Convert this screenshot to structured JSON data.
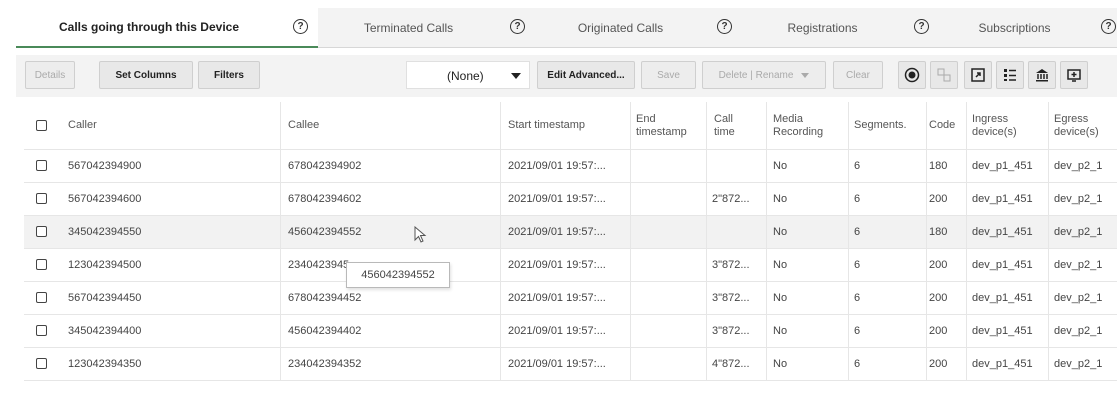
{
  "tabs": [
    {
      "label": "Calls going through this Device",
      "active": true
    },
    {
      "label": "Terminated Calls",
      "active": false
    },
    {
      "label": "Originated Calls",
      "active": false
    },
    {
      "label": "Registrations",
      "active": false
    },
    {
      "label": "Subscriptions",
      "active": false
    }
  ],
  "help_glyph": "?",
  "toolbar": {
    "details_label": "Details",
    "set_columns_label": "Set Columns",
    "filters_label": "Filters",
    "view_select_value": "(None)",
    "edit_advanced_label": "Edit Advanced...",
    "save_label": "Save",
    "delete_rename_label": "Delete | Rename",
    "clear_label": "Clear",
    "icons": [
      "record-icon",
      "compare-icon",
      "export-icon",
      "list-icon",
      "bank-icon",
      "display-icon"
    ]
  },
  "table": {
    "headers": {
      "caller": "Caller",
      "callee": "Callee",
      "start_timestamp": "Start timestamp",
      "end_timestamp": "End timestamp",
      "call_time": "Call time",
      "media_recording": "Media Recording",
      "segments": "Segments.",
      "code": "Code",
      "ingress_device": "Ingress device(s)",
      "egress_device": "Egress device(s)"
    },
    "rows": [
      {
        "caller": "567042394900",
        "callee": "678042394902",
        "start": "2021/09/01 19:57:...",
        "end": "",
        "call_time": "",
        "media": "No",
        "segments": "6",
        "code": "180",
        "ingress": "dev_p1_451",
        "egress": "dev_p2_1"
      },
      {
        "caller": "567042394600",
        "callee": "678042394602",
        "start": "2021/09/01 19:57:...",
        "end": "",
        "call_time": "2\"872...",
        "media": "No",
        "segments": "6",
        "code": "200",
        "ingress": "dev_p1_451",
        "egress": "dev_p2_1"
      },
      {
        "caller": "345042394550",
        "callee": "456042394552",
        "start": "2021/09/01 19:57:...",
        "end": "",
        "call_time": "",
        "media": "No",
        "segments": "6",
        "code": "180",
        "ingress": "dev_p1_451",
        "egress": "dev_p2_1"
      },
      {
        "caller": "123042394500",
        "callee": "2340423945",
        "start": "2021/09/01 19:57:...",
        "end": "",
        "call_time": "3\"872...",
        "media": "No",
        "segments": "6",
        "code": "200",
        "ingress": "dev_p1_451",
        "egress": "dev_p2_1"
      },
      {
        "caller": "567042394450",
        "callee": "678042394452",
        "start": "2021/09/01 19:57:...",
        "end": "",
        "call_time": "3\"872...",
        "media": "No",
        "segments": "6",
        "code": "200",
        "ingress": "dev_p1_451",
        "egress": "dev_p2_1"
      },
      {
        "caller": "345042394400",
        "callee": "456042394402",
        "start": "2021/09/01 19:57:...",
        "end": "",
        "call_time": "3\"872...",
        "media": "No",
        "segments": "6",
        "code": "200",
        "ingress": "dev_p1_451",
        "egress": "dev_p2_1"
      },
      {
        "caller": "123042394350",
        "callee": "234042394352",
        "start": "2021/09/01 19:57:...",
        "end": "",
        "call_time": "4\"872...",
        "media": "No",
        "segments": "6",
        "code": "200",
        "ingress": "dev_p1_451",
        "egress": "dev_p2_1"
      }
    ]
  },
  "tooltip": {
    "text": "456042394552"
  },
  "colors": {
    "active_tab_underline": "#4a8a59",
    "toolbar_bg": "#f3f3f3",
    "row_highlight": "#f2f2f2"
  }
}
